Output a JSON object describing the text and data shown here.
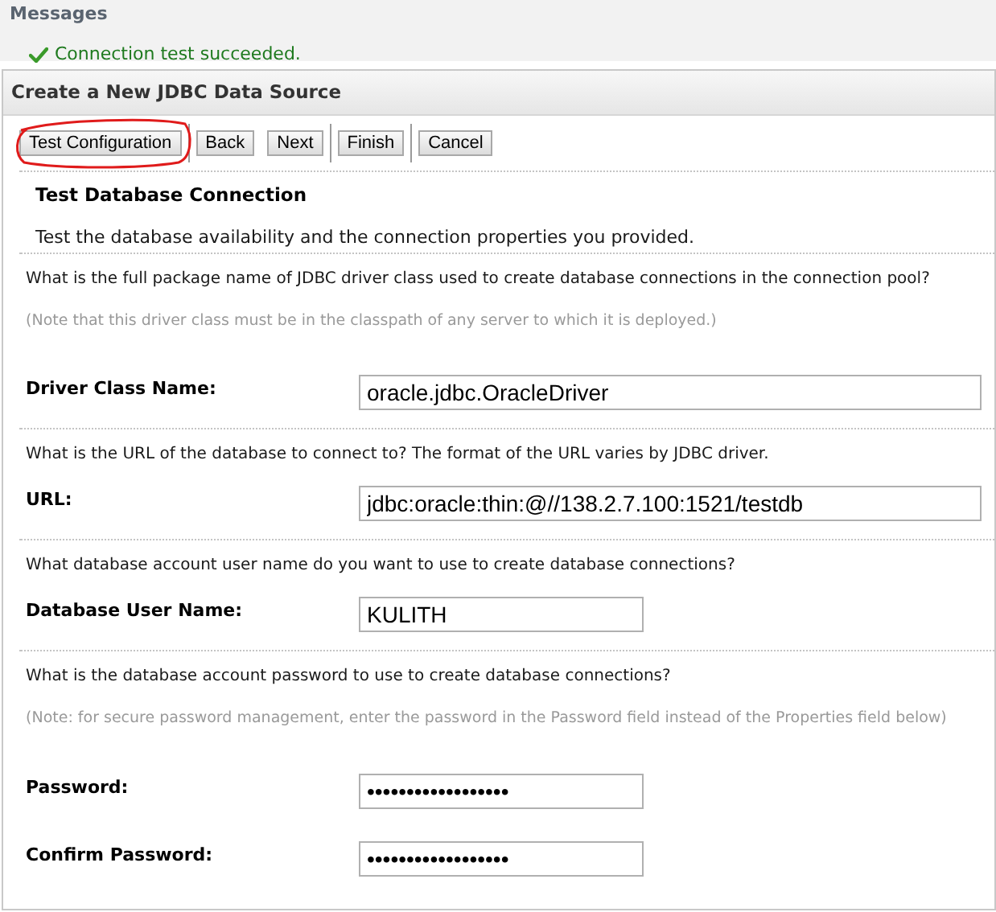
{
  "messages": {
    "title": "Messages",
    "items": [
      {
        "kind": "success",
        "text": "Connection test succeeded."
      }
    ]
  },
  "panel": {
    "title": "Create a New JDBC Data Source",
    "toolbar": [
      {
        "label": "Test Configuration",
        "highlighted": true
      },
      {
        "label": "Back",
        "highlighted": false
      },
      {
        "label": "Next",
        "highlighted": false
      },
      {
        "label": "Finish",
        "highlighted": false
      },
      {
        "label": "Cancel",
        "highlighted": false
      }
    ],
    "section_title": "Test Database Connection",
    "section_description": "Test the database availability and the connection properties you provided.",
    "groups": [
      {
        "question": "What is the full package name of JDBC driver class used to create database connections in the connection pool?",
        "note": "(Note that this driver class must be in the classpath of any server to which it is deployed.)",
        "fields": [
          {
            "label": "Driver Class Name:",
            "value": "oracle.jdbc.OracleDriver"
          }
        ]
      },
      {
        "question": "What is the URL of the database to connect to? The format of the URL varies by JDBC driver.",
        "fields": [
          {
            "label": "URL:",
            "value": "jdbc:oracle:thin:@//138.2.7.100:1521/testdb"
          }
        ]
      },
      {
        "question": "What database account user name do you want to use to create database connections?",
        "fields": [
          {
            "label": "Database User Name:",
            "value": "KULITH"
          }
        ]
      },
      {
        "question": "What is the database account password to use to create database connections?",
        "note": "(Note: for secure password management, enter the password in the Password field instead of the Properties field below)",
        "fields": [
          {
            "label": "Password:",
            "value": "••••••••••••••••••"
          },
          {
            "label": "Confirm Password:",
            "value": "••••••••••••••••••"
          }
        ]
      }
    ]
  }
}
